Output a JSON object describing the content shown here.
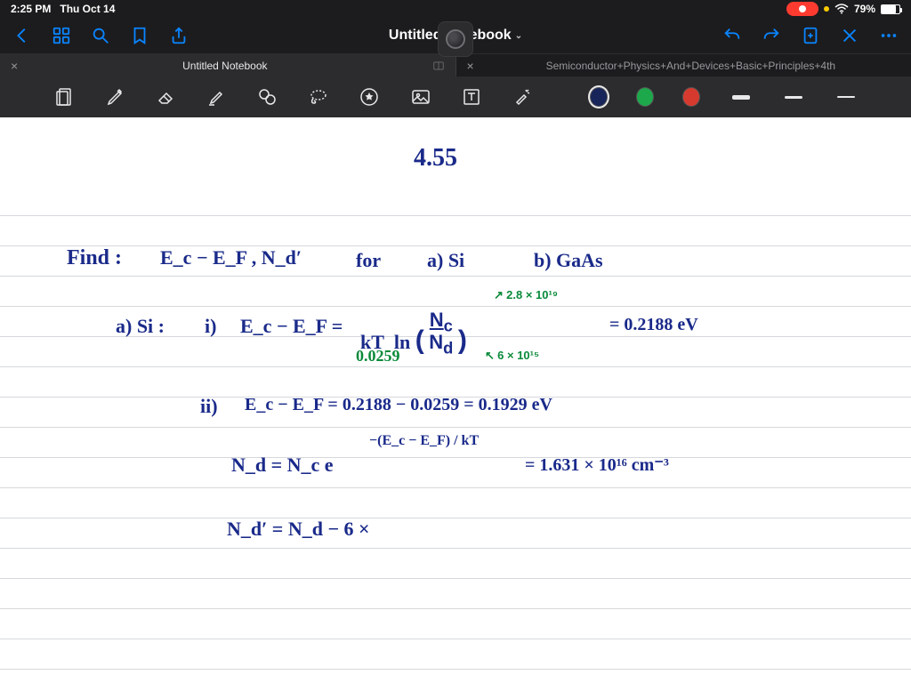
{
  "status": {
    "time": "2:25 PM",
    "date": "Thu Oct 14",
    "battery_pct": "79%",
    "battery_fill_pct": 79
  },
  "nav": {
    "title": "Untitled Notebook",
    "icons": {
      "back": "chevron-left",
      "dashboard": "grid",
      "search": "magnify",
      "bookmark": "bookmark",
      "share": "share-up",
      "undo": "undo",
      "redo": "redo",
      "add_page": "page-plus",
      "close": "close-x",
      "more": "ellipsis"
    }
  },
  "tabs": [
    {
      "label": "Untitled Notebook",
      "active": true
    },
    {
      "label": "Semiconductor+Physics+And+Devices+Basic+Principles+4th",
      "active": false
    }
  ],
  "tools": {
    "items": [
      "page-nav",
      "pen",
      "eraser",
      "highlighter",
      "shapes",
      "lasso",
      "favorites",
      "image",
      "text",
      "laser"
    ],
    "active": "pen",
    "colors": [
      {
        "name": "navy",
        "hex": "#17255a",
        "selected": true
      },
      {
        "name": "green",
        "hex": "#1ea84c",
        "selected": false
      },
      {
        "name": "red",
        "hex": "#d63a2f",
        "selected": false
      }
    ],
    "weights": [
      {
        "px": 5,
        "selected": true
      },
      {
        "px": 3,
        "selected": false
      },
      {
        "px": 2,
        "selected": false
      }
    ]
  },
  "notes": {
    "problem_no": "4.55",
    "find_label": "Find :",
    "find_expr": "E_c − E_F  ,  N_d′",
    "for_label": "for",
    "case_a": "a)   Si",
    "case_b": "b)   GaAs",
    "a_label": "a)  Si :",
    "i_label": "i)",
    "i_expr_lhs": "E_c − E_F  =",
    "i_expr_rhs": "kT  ln ( N_c / N_d )",
    "nc_val_annot": "2.8 × 10¹⁹",
    "nd_val_annot": "6 × 10¹⁵",
    "kt_val": "0.0259",
    "i_result": "=   0.2188  eV",
    "ii_label": "ii)",
    "ii_expr": "E_c − E_F  =  0.2188 − 0.0259   =   0.1929  eV",
    "nd_formula_lhs": "N_d  =  N_c e",
    "nd_formula_exp": "−(E_c − E_F) / kT",
    "nd_formula_res": "=  1.631 × 10¹⁶  cm⁻³",
    "nd_prime": "N_d′  =  N_d − 6 ×"
  }
}
